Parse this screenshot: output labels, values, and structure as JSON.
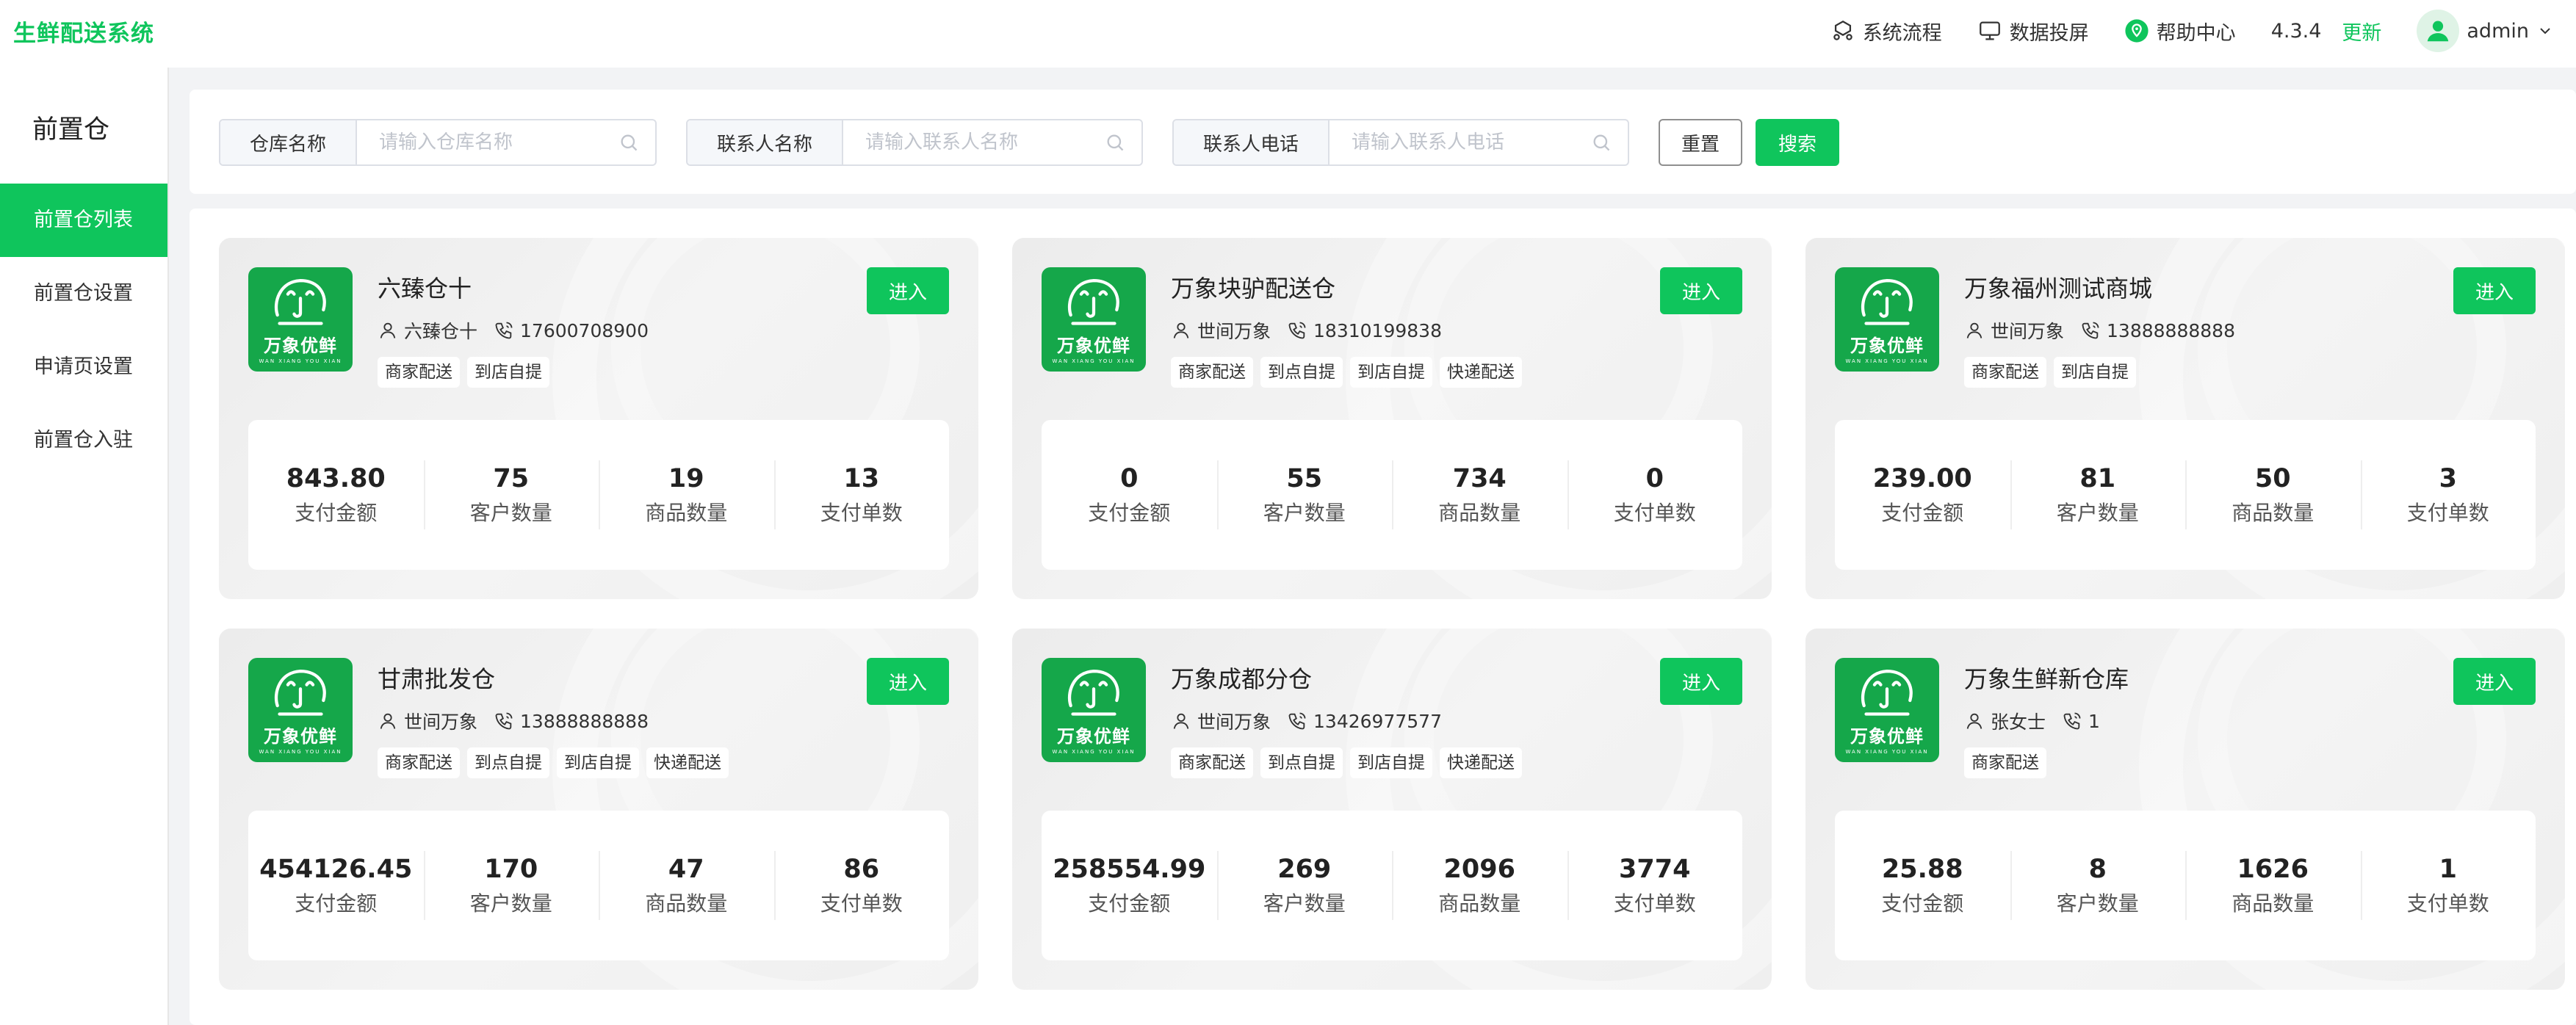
{
  "app": {
    "title": "生鲜配送系统"
  },
  "header": {
    "process_label": "系统流程",
    "screen_label": "数据投屏",
    "help_label": "帮助中心",
    "version": "4.3.4",
    "update_label": "更新",
    "username": "admin"
  },
  "sidebar": {
    "title": "前置仓",
    "items": [
      {
        "label": "前置仓列表"
      },
      {
        "label": "前置仓设置"
      },
      {
        "label": "申请页设置"
      },
      {
        "label": "前置仓入驻"
      }
    ]
  },
  "filters": {
    "warehouse_label": "仓库名称",
    "warehouse_placeholder": "请输入仓库名称",
    "contact_label": "联系人名称",
    "contact_placeholder": "请输入联系人名称",
    "phone_label": "联系人电话",
    "phone_placeholder": "请输入联系人电话",
    "reset_label": "重置",
    "search_label": "搜索"
  },
  "card_common": {
    "logo_text": "万象优鲜",
    "logo_sub": "WAN XIANG YOU XIAN",
    "enter_label": "进入",
    "stat_labels": [
      "支付金额",
      "客户数量",
      "商品数量",
      "支付单数"
    ]
  },
  "cards": [
    {
      "name": "六臻仓十",
      "contact": "六臻仓十",
      "phone": "17600708900",
      "tags": [
        "商家配送",
        "到店自提"
      ],
      "stats": [
        "843.80",
        "75",
        "19",
        "13"
      ]
    },
    {
      "name": "万象块驴配送仓",
      "contact": "世间万象",
      "phone": "18310199838",
      "tags": [
        "商家配送",
        "到点自提",
        "到店自提",
        "快递配送"
      ],
      "stats": [
        "0",
        "55",
        "734",
        "0"
      ]
    },
    {
      "name": "万象福州测试商城",
      "contact": "世间万象",
      "phone": "13888888888",
      "tags": [
        "商家配送",
        "到店自提"
      ],
      "stats": [
        "239.00",
        "81",
        "50",
        "3"
      ]
    },
    {
      "name": "甘肃批发仓",
      "contact": "世间万象",
      "phone": "13888888888",
      "tags": [
        "商家配送",
        "到点自提",
        "到店自提",
        "快递配送"
      ],
      "stats": [
        "454126.45",
        "170",
        "47",
        "86"
      ]
    },
    {
      "name": "万象成都分仓",
      "contact": "世间万象",
      "phone": "13426977577",
      "tags": [
        "商家配送",
        "到点自提",
        "到店自提",
        "快递配送"
      ],
      "stats": [
        "258554.99",
        "269",
        "2096",
        "3774"
      ]
    },
    {
      "name": "万象生鲜新仓库",
      "contact": "张女士",
      "phone": "1",
      "tags": [
        "商家配送"
      ],
      "stats": [
        "25.88",
        "8",
        "1626",
        "1"
      ]
    }
  ]
}
